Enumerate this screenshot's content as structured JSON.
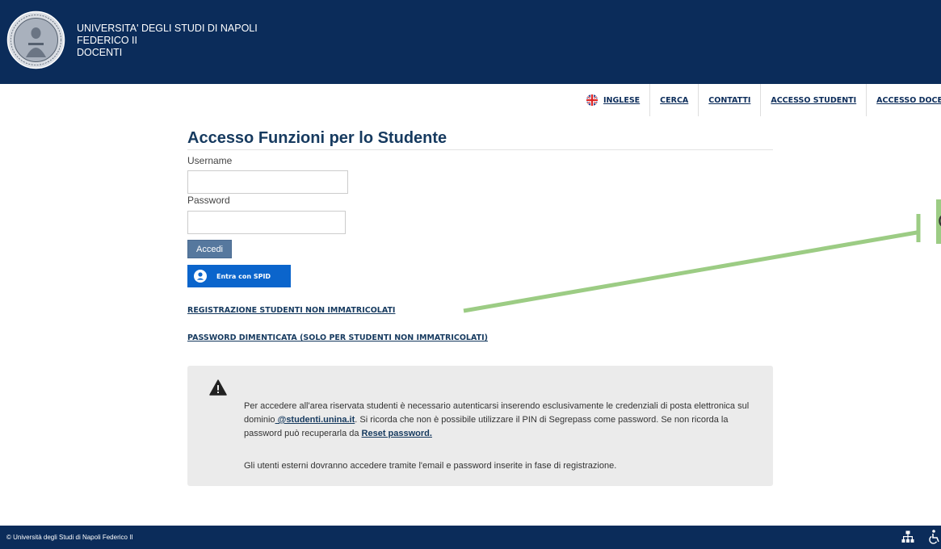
{
  "header": {
    "line1": "UNIVERSITA' DEGLI STUDI DI NAPOLI",
    "line2": "FEDERICO II",
    "line3": "DOCENTI",
    "logo_icon": "university-seal-icon"
  },
  "topnav": {
    "items": [
      {
        "label": "INGLESE",
        "icon": "uk-flag-icon"
      },
      {
        "label": "CERCA"
      },
      {
        "label": "CONTATTI"
      },
      {
        "label": "ACCESSO STUDENTI"
      },
      {
        "label": "ACCESSO DOCENTI"
      }
    ]
  },
  "login": {
    "title": "Accesso Funzioni per lo Studente",
    "username_label": "Username",
    "username_value": "",
    "password_label": "Password",
    "password_value": "",
    "submit_label": "Accedi",
    "spid_label": "Entra con SPID"
  },
  "links": {
    "registration": "REGISTRAZIONE STUDENTI NON IMMATRICOLATI",
    "forgot_password": "PASSWORD DIMENTICATA (SOLO PER STUDENTI NON IMMATRICOLATI)"
  },
  "notice": {
    "p1_part1": "Per accedere all'area riservata studenti è necessario autenticarsi inserendo esclusivamente le credenziali di posta elettronica sul dominio",
    "p1_domain": " @studenti.unina.it",
    "p1_part2": ". Si ricorda che non è possibile utilizzare il PIN di Segrepass come password. Se non ricorda la password può recuperarla da ",
    "p1_reset": "Reset password.",
    "p2": "Gli utenti esterni dovranno accedere tramite l'email e password inserite in fase di registrazione."
  },
  "annotation": {
    "partial_text": "C"
  },
  "footer": {
    "copyright": "© Università degli Studi di Napoli Federico II"
  },
  "colors": {
    "header_bg": "#0b2c5a",
    "accent": "#163a5f",
    "button": "#56789e",
    "spid": "#0b65cc",
    "annotation_green": "#9ccc84"
  }
}
